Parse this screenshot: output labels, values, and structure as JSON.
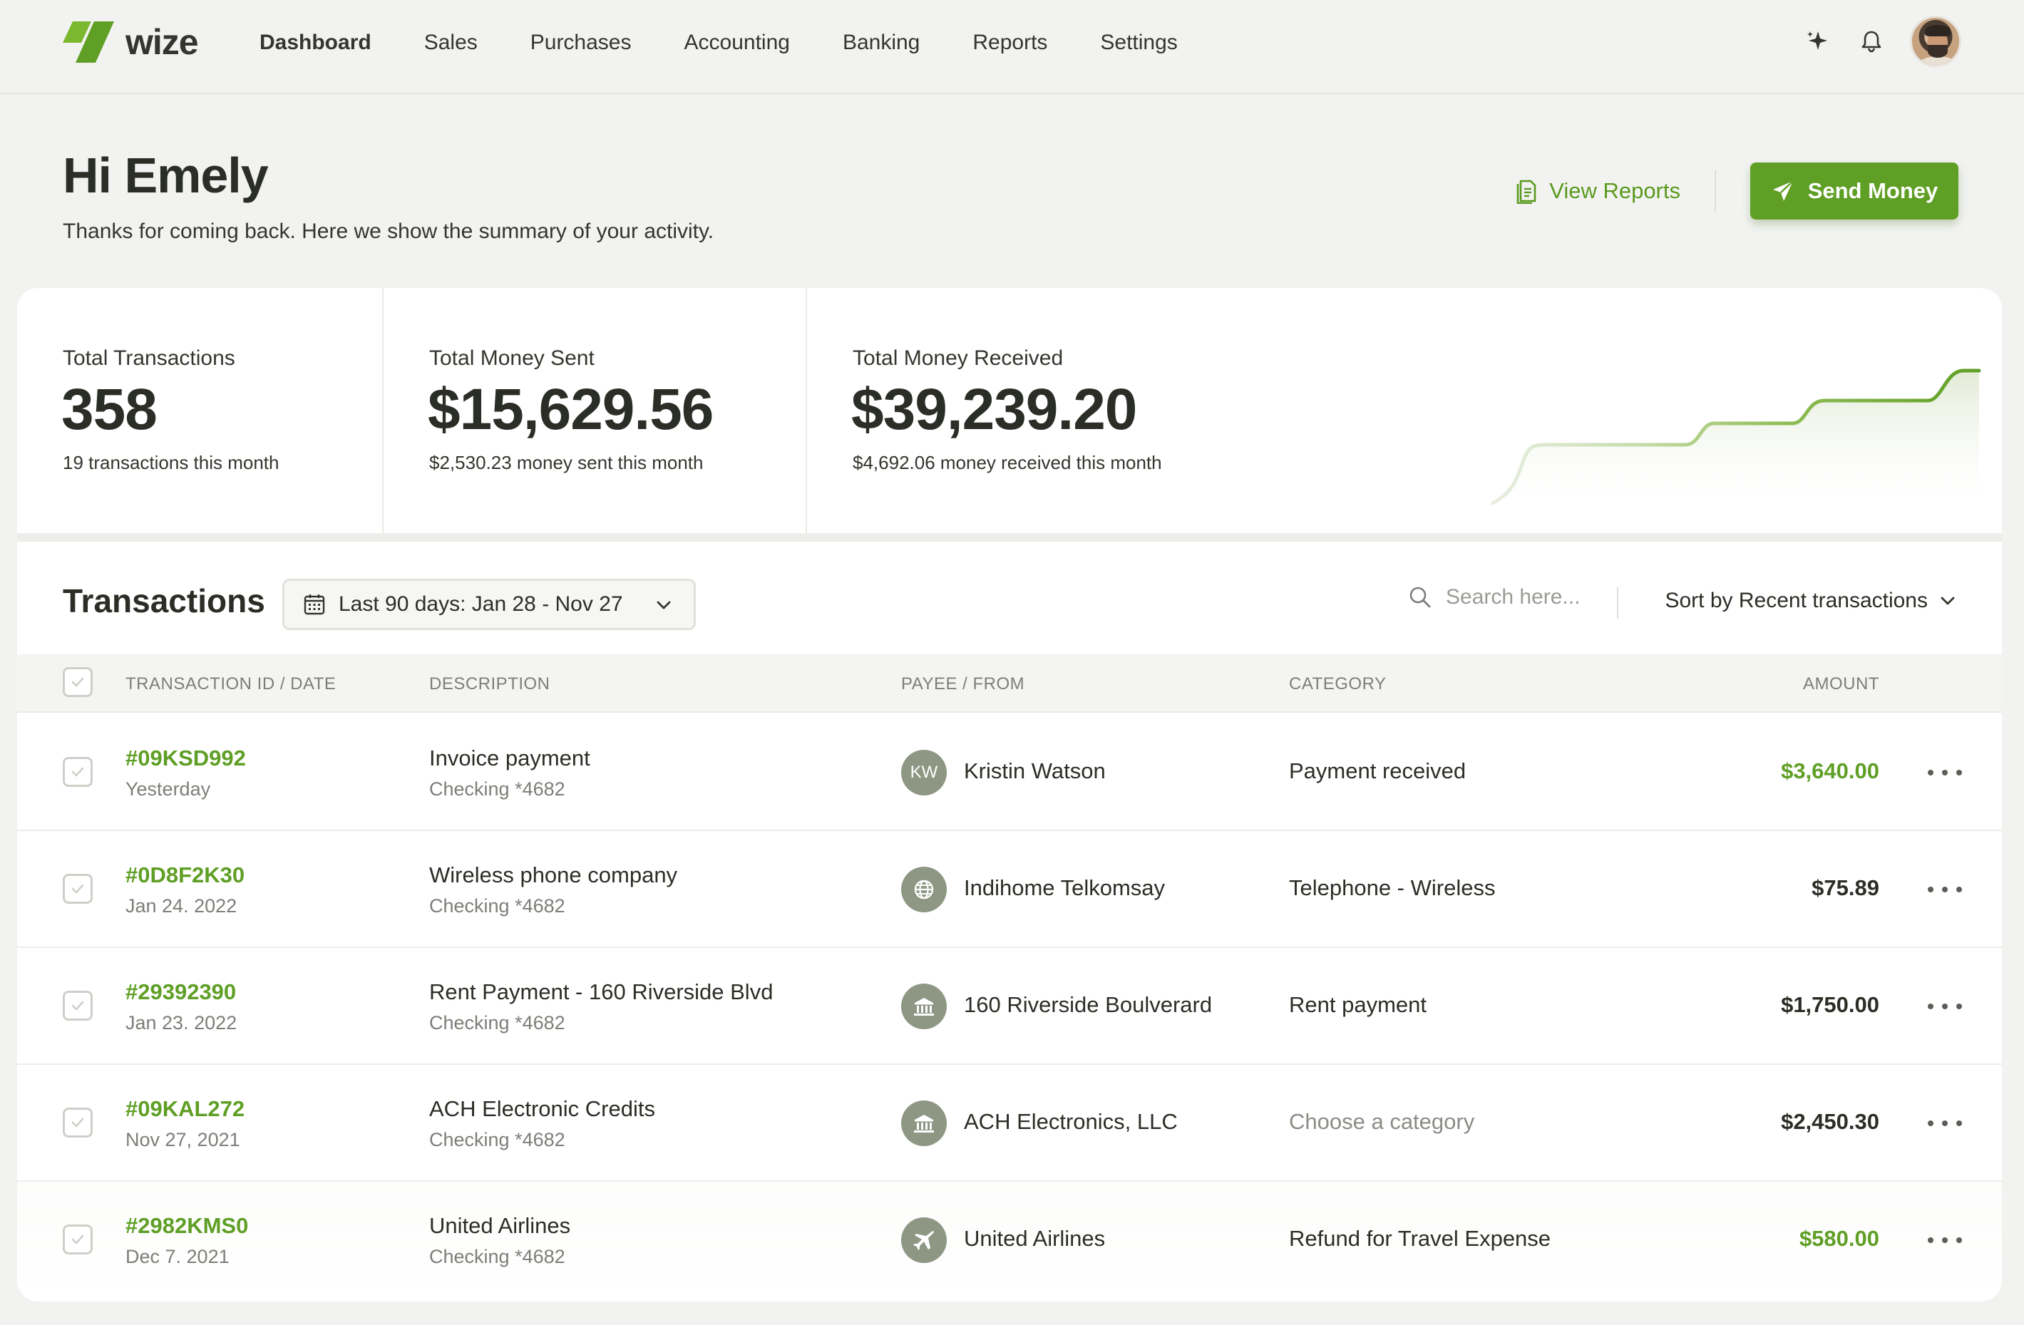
{
  "brand": {
    "name": "wize",
    "accent": "#5f9f25"
  },
  "nav": {
    "items": [
      {
        "label": "Dashboard",
        "active": true
      },
      {
        "label": "Sales",
        "active": false
      },
      {
        "label": "Purchases",
        "active": false
      },
      {
        "label": "Accounting",
        "active": false
      },
      {
        "label": "Banking",
        "active": false
      },
      {
        "label": "Reports",
        "active": false
      },
      {
        "label": "Settings",
        "active": false
      }
    ],
    "icons": [
      "sparkle-icon",
      "bell-icon",
      "avatar"
    ]
  },
  "header": {
    "title": "Hi Emely",
    "subtitle": "Thanks for coming back. Here we show the summary of your activity.",
    "view_reports_label": "View Reports",
    "send_money_label": "Send Money"
  },
  "stats": [
    {
      "label": "Total Transactions",
      "value": "358",
      "note": "19 transactions this month"
    },
    {
      "label": "Total Money Sent",
      "value": "$15,629.56",
      "note": "$2,530.23 money sent this month"
    },
    {
      "label": "Total Money Received",
      "value": "$39,239.20",
      "note": "$4,692.06 money received this month"
    }
  ],
  "transactions": {
    "title": "Transactions",
    "date_filter": "Last 90 days: Jan 28 - Nov 27",
    "search_placeholder": "Search here...",
    "sort_label": "Sort by Recent transactions",
    "columns": {
      "id_date": "TRANSACTION ID / DATE",
      "description": "DESCRIPTION",
      "payee": "PAYEE / FROM",
      "category": "CATEGORY",
      "amount": "AMOUNT"
    },
    "rows": [
      {
        "id": "#09KSD992",
        "date": "Yesterday",
        "description": "Invoice payment",
        "account": "Checking *4682",
        "payee_initials": "KW",
        "payee_icon": "initials",
        "payee": "Kristin Watson",
        "category": "Payment received",
        "amount": "$3,640.00",
        "amount_positive": true
      },
      {
        "id": "#0D8F2K30",
        "date": "Jan 24. 2022",
        "description": "Wireless phone company",
        "account": "Checking *4682",
        "payee_initials": "",
        "payee_icon": "globe-icon",
        "payee": "Indihome Telkomsay",
        "category": "Telephone - Wireless",
        "amount": "$75.89",
        "amount_positive": false
      },
      {
        "id": "#29392390",
        "date": "Jan 23. 2022",
        "description": "Rent Payment - 160 Riverside Blvd",
        "account": "Checking *4682",
        "payee_initials": "",
        "payee_icon": "bank-icon",
        "payee": "160 Riverside Boulverard",
        "category": "Rent payment",
        "amount": "$1,750.00",
        "amount_positive": false
      },
      {
        "id": "#09KAL272",
        "date": "Nov 27, 2021",
        "description": "ACH Electronic Credits",
        "account": "Checking *4682",
        "payee_initials": "",
        "payee_icon": "bank-icon",
        "payee": "ACH Electronics, LLC",
        "category": "Choose a category",
        "category_placeholder": true,
        "amount": "$2,450.30",
        "amount_positive": false
      },
      {
        "id": "#2982KMS0",
        "date": "Dec 7. 2021",
        "description": "United Airlines",
        "account": "Checking *4682",
        "payee_initials": "",
        "payee_icon": "plane-icon",
        "payee": "United Airlines",
        "category": "Refund for Travel Expense",
        "amount": "$580.00",
        "amount_positive": true
      }
    ]
  }
}
